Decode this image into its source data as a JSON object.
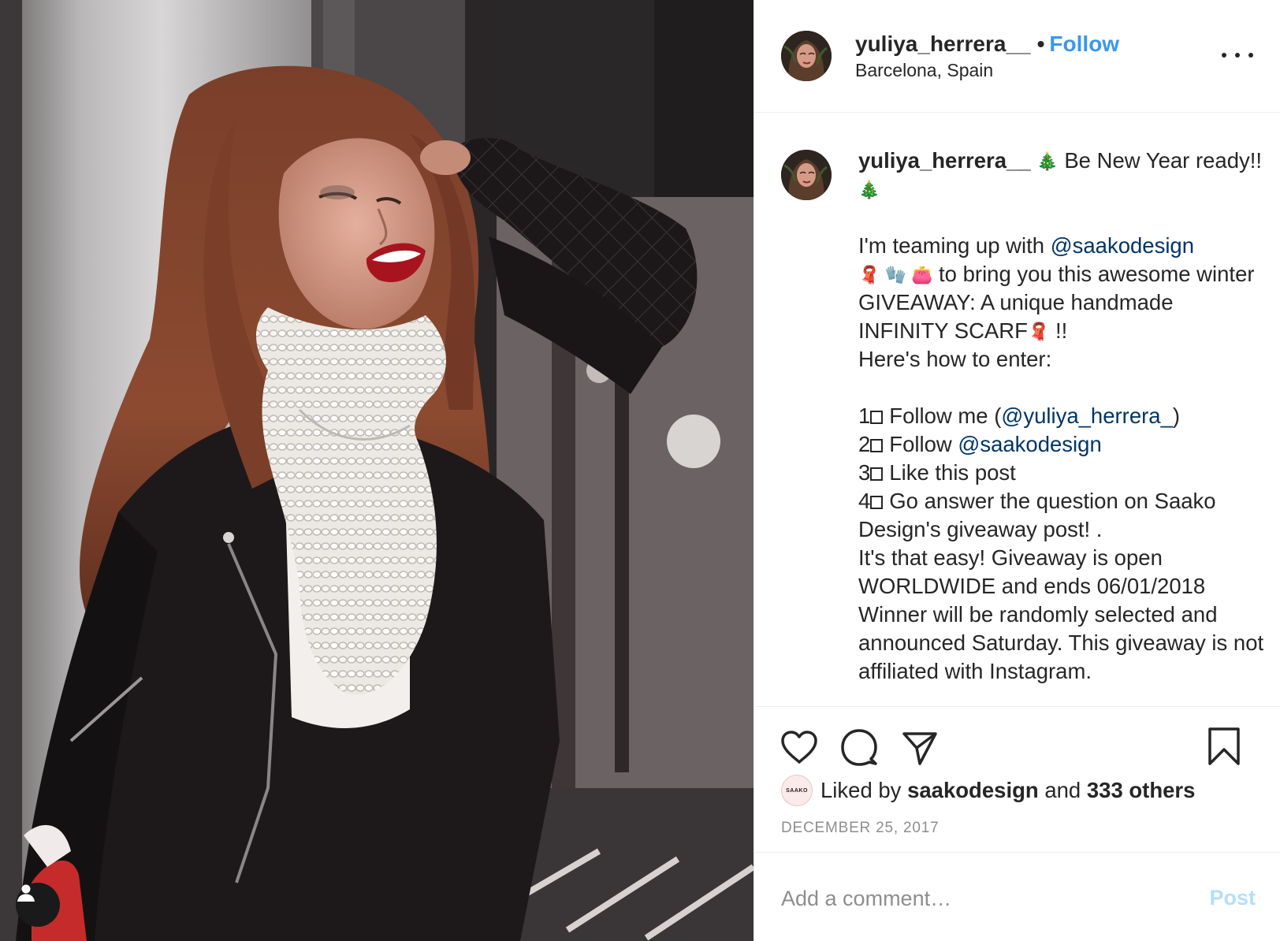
{
  "post": {
    "image_alt": "Woman with long auburn hair wearing a white chunky knit infinity scarf and black leather jacket, laughing with eyes closed against a street background",
    "tag_icon": "user-tag-icon"
  },
  "header": {
    "username": "yuliya_herrera__",
    "separator": "•",
    "follow_label": "Follow",
    "location": "Barcelona, Spain",
    "more_icon": "more-options-icon"
  },
  "caption": {
    "username": "yuliya_herrera__",
    "line1_emoji": "🎄",
    "line1_text": "Be New Year ready!!",
    "line1_end_emoji": "🎄",
    "intro_text": "I'm teaming up with",
    "intro_mention": "@saakodesign",
    "intro_emojis": "🧣 🧤 👛",
    "intro_rest": "to bring you this awesome winter GIVEAWAY: A unique handmade INFINITY SCARF",
    "scarf_emoji": "🧣",
    "intro_end": "!!",
    "how_to": "Here's how to enter:",
    "steps": [
      {
        "number": "1",
        "text": "Follow me (",
        "mention": "@yuliya_herrera_",
        "suffix": ")"
      },
      {
        "number": "2",
        "text": "Follow ",
        "mention": "@saakodesign",
        "suffix": ""
      },
      {
        "number": "3",
        "text": "Like this post",
        "mention": "",
        "suffix": ""
      },
      {
        "number": "4",
        "text": "Go answer the question on Saako Design's giveaway post! .",
        "mention": "",
        "suffix": ""
      }
    ],
    "outro": "It's that easy! Giveaway is open WORLDWIDE and ends 06/01/2018 Winner will be randomly selected and announced Saturday. This giveaway is not affiliated with Instagram."
  },
  "actions": {
    "like_icon": "heart-icon",
    "comment_icon": "comment-icon",
    "share_icon": "share-icon",
    "save_icon": "bookmark-icon",
    "liker_avatar_text": "SAAKO",
    "liked_by_prefix": "Liked by",
    "liked_by_user": "saakodesign",
    "liked_by_and": "and",
    "liked_by_others": "333 others",
    "date": "DECEMBER 25, 2017"
  },
  "comment": {
    "placeholder": "Add a comment…",
    "post_label": "Post"
  },
  "colors": {
    "link_blue": "#3897f0",
    "mention_blue": "#003569",
    "muted_gray": "#8e8e8e",
    "post_disabled": "#b2dffc",
    "divider": "#efefef"
  }
}
